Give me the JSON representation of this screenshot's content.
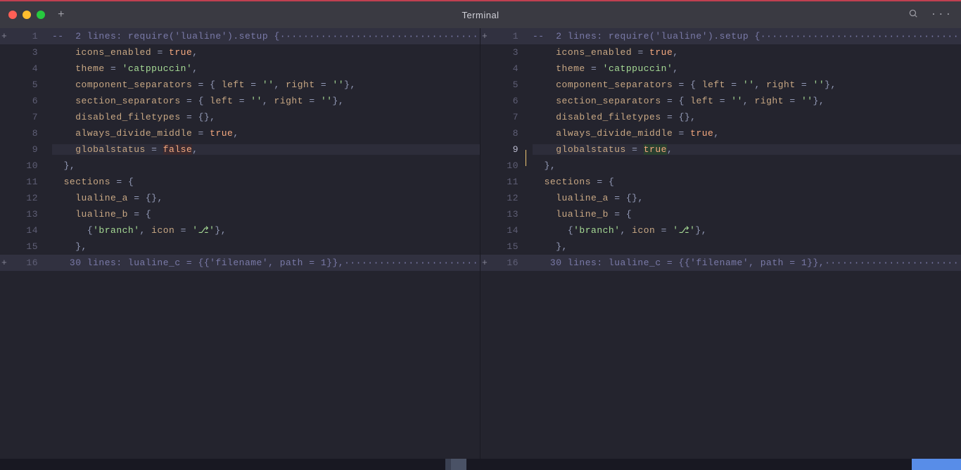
{
  "window": {
    "title": "Terminal",
    "newTabGlyph": "+",
    "moreGlyph": "···"
  },
  "panes": [
    {
      "side": "left",
      "lines": [
        {
          "num": "1",
          "fold": "+",
          "folded": true,
          "tokens": [
            {
              "t": "--  2 lines: require('lualine').setup {",
              "cls": "folded-text"
            }
          ],
          "trailDots": true
        },
        {
          "num": "3",
          "tokens": [
            {
              "t": "    ",
              "cls": ""
            },
            {
              "t": "icons_enabled",
              "cls": "key"
            },
            {
              "t": " = ",
              "cls": "op"
            },
            {
              "t": "true",
              "cls": "bool"
            },
            {
              "t": ",",
              "cls": "punc"
            }
          ]
        },
        {
          "num": "4",
          "tokens": [
            {
              "t": "    ",
              "cls": ""
            },
            {
              "t": "theme",
              "cls": "key"
            },
            {
              "t": " = ",
              "cls": "op"
            },
            {
              "t": "'catppuccin'",
              "cls": "str"
            },
            {
              "t": ",",
              "cls": "punc"
            }
          ]
        },
        {
          "num": "5",
          "tokens": [
            {
              "t": "    ",
              "cls": ""
            },
            {
              "t": "component_separators",
              "cls": "key"
            },
            {
              "t": " = ",
              "cls": "op"
            },
            {
              "t": "{ ",
              "cls": "punc"
            },
            {
              "t": "left",
              "cls": "key"
            },
            {
              "t": " = ",
              "cls": "op"
            },
            {
              "t": "''",
              "cls": "str"
            },
            {
              "t": ", ",
              "cls": "punc"
            },
            {
              "t": "right",
              "cls": "key"
            },
            {
              "t": " = ",
              "cls": "op"
            },
            {
              "t": "''",
              "cls": "str"
            },
            {
              "t": "},",
              "cls": "punc"
            }
          ]
        },
        {
          "num": "6",
          "tokens": [
            {
              "t": "    ",
              "cls": ""
            },
            {
              "t": "section_separators",
              "cls": "key"
            },
            {
              "t": " = ",
              "cls": "op"
            },
            {
              "t": "{ ",
              "cls": "punc"
            },
            {
              "t": "left",
              "cls": "key"
            },
            {
              "t": " = ",
              "cls": "op"
            },
            {
              "t": "''",
              "cls": "str"
            },
            {
              "t": ", ",
              "cls": "punc"
            },
            {
              "t": "right",
              "cls": "key"
            },
            {
              "t": " = ",
              "cls": "op"
            },
            {
              "t": "''",
              "cls": "str"
            },
            {
              "t": "},",
              "cls": "punc"
            }
          ]
        },
        {
          "num": "7",
          "tokens": [
            {
              "t": "    ",
              "cls": ""
            },
            {
              "t": "disabled_filetypes",
              "cls": "key"
            },
            {
              "t": " = ",
              "cls": "op"
            },
            {
              "t": "{}",
              "cls": "punc"
            },
            {
              "t": ",",
              "cls": "punc"
            }
          ]
        },
        {
          "num": "8",
          "tokens": [
            {
              "t": "    ",
              "cls": ""
            },
            {
              "t": "always_divide_middle",
              "cls": "key"
            },
            {
              "t": " = ",
              "cls": "op"
            },
            {
              "t": "true",
              "cls": "bool"
            },
            {
              "t": ",",
              "cls": "punc"
            }
          ]
        },
        {
          "num": "9",
          "hl": true,
          "tokens": [
            {
              "t": "    ",
              "cls": ""
            },
            {
              "t": "globalstatus",
              "cls": "key"
            },
            {
              "t": " = ",
              "cls": "op"
            },
            {
              "t": "false",
              "cls": "bool-diff",
              "diffRemoved": true
            },
            {
              "t": ",",
              "cls": "punc"
            }
          ]
        },
        {
          "num": "10",
          "tokens": [
            {
              "t": "  ",
              "cls": ""
            },
            {
              "t": "},",
              "cls": "punc"
            }
          ]
        },
        {
          "num": "11",
          "tokens": [
            {
              "t": "  ",
              "cls": ""
            },
            {
              "t": "sections",
              "cls": "key"
            },
            {
              "t": " = ",
              "cls": "op"
            },
            {
              "t": "{",
              "cls": "punc"
            }
          ]
        },
        {
          "num": "12",
          "tokens": [
            {
              "t": "    ",
              "cls": ""
            },
            {
              "t": "lualine_a",
              "cls": "key"
            },
            {
              "t": " = ",
              "cls": "op"
            },
            {
              "t": "{}",
              "cls": "punc"
            },
            {
              "t": ",",
              "cls": "punc"
            }
          ]
        },
        {
          "num": "13",
          "tokens": [
            {
              "t": "    ",
              "cls": ""
            },
            {
              "t": "lualine_b",
              "cls": "key"
            },
            {
              "t": " = ",
              "cls": "op"
            },
            {
              "t": "{",
              "cls": "punc"
            }
          ]
        },
        {
          "num": "14",
          "tokens": [
            {
              "t": "      ",
              "cls": ""
            },
            {
              "t": "{",
              "cls": "punc"
            },
            {
              "t": "'branch'",
              "cls": "str"
            },
            {
              "t": ", ",
              "cls": "punc"
            },
            {
              "t": "icon",
              "cls": "key"
            },
            {
              "t": " = ",
              "cls": "op"
            },
            {
              "t": "'⎇'",
              "cls": "str"
            },
            {
              "t": "}",
              "cls": "punc"
            },
            {
              "t": ",",
              "cls": "punc"
            }
          ]
        },
        {
          "num": "15",
          "tokens": [
            {
              "t": "    ",
              "cls": ""
            },
            {
              "t": "},",
              "cls": "punc"
            }
          ]
        },
        {
          "num": "16",
          "fold": "+",
          "folded": true,
          "tokens": [
            {
              "t": "   30 lines: lualine_c = {{'filename', path = 1}},",
              "cls": "folded-text"
            }
          ],
          "trailDots": true
        }
      ]
    },
    {
      "side": "right",
      "cursorLine": 7,
      "lines": [
        {
          "num": "1",
          "fold": "+",
          "folded": true,
          "tokens": [
            {
              "t": "--  2 lines: require('lualine').setup {",
              "cls": "folded-text"
            }
          ],
          "trailDots": true
        },
        {
          "num": "3",
          "tokens": [
            {
              "t": "    ",
              "cls": ""
            },
            {
              "t": "icons_enabled",
              "cls": "key"
            },
            {
              "t": " = ",
              "cls": "op"
            },
            {
              "t": "true",
              "cls": "bool"
            },
            {
              "t": ",",
              "cls": "punc"
            }
          ]
        },
        {
          "num": "4",
          "tokens": [
            {
              "t": "    ",
              "cls": ""
            },
            {
              "t": "theme",
              "cls": "key"
            },
            {
              "t": " = ",
              "cls": "op"
            },
            {
              "t": "'catppuccin'",
              "cls": "str"
            },
            {
              "t": ",",
              "cls": "punc"
            }
          ]
        },
        {
          "num": "5",
          "tokens": [
            {
              "t": "    ",
              "cls": ""
            },
            {
              "t": "component_separators",
              "cls": "key"
            },
            {
              "t": " = ",
              "cls": "op"
            },
            {
              "t": "{ ",
              "cls": "punc"
            },
            {
              "t": "left",
              "cls": "key"
            },
            {
              "t": " = ",
              "cls": "op"
            },
            {
              "t": "''",
              "cls": "str"
            },
            {
              "t": ", ",
              "cls": "punc"
            },
            {
              "t": "right",
              "cls": "key"
            },
            {
              "t": " = ",
              "cls": "op"
            },
            {
              "t": "''",
              "cls": "str"
            },
            {
              "t": "},",
              "cls": "punc"
            }
          ]
        },
        {
          "num": "6",
          "tokens": [
            {
              "t": "    ",
              "cls": ""
            },
            {
              "t": "section_separators",
              "cls": "key"
            },
            {
              "t": " = ",
              "cls": "op"
            },
            {
              "t": "{ ",
              "cls": "punc"
            },
            {
              "t": "left",
              "cls": "key"
            },
            {
              "t": " = ",
              "cls": "op"
            },
            {
              "t": "''",
              "cls": "str"
            },
            {
              "t": ", ",
              "cls": "punc"
            },
            {
              "t": "right",
              "cls": "key"
            },
            {
              "t": " = ",
              "cls": "op"
            },
            {
              "t": "''",
              "cls": "str"
            },
            {
              "t": "},",
              "cls": "punc"
            }
          ]
        },
        {
          "num": "7",
          "tokens": [
            {
              "t": "    ",
              "cls": ""
            },
            {
              "t": "disabled_filetypes",
              "cls": "key"
            },
            {
              "t": " = ",
              "cls": "op"
            },
            {
              "t": "{}",
              "cls": "punc"
            },
            {
              "t": ",",
              "cls": "punc"
            }
          ]
        },
        {
          "num": "8",
          "tokens": [
            {
              "t": "    ",
              "cls": ""
            },
            {
              "t": "always_divide_middle",
              "cls": "key"
            },
            {
              "t": " = ",
              "cls": "op"
            },
            {
              "t": "true",
              "cls": "bool"
            },
            {
              "t": ",",
              "cls": "punc"
            }
          ]
        },
        {
          "num": "9",
          "hl": true,
          "cursor": true,
          "current": true,
          "tokens": [
            {
              "t": "    ",
              "cls": ""
            },
            {
              "t": "globalstatus",
              "cls": "key"
            },
            {
              "t": " = ",
              "cls": "op"
            },
            {
              "t": "true",
              "cls": "bool-diff",
              "diffAdded": true
            },
            {
              "t": ",",
              "cls": "punc"
            }
          ]
        },
        {
          "num": "10",
          "tokens": [
            {
              "t": "  ",
              "cls": ""
            },
            {
              "t": "},",
              "cls": "punc"
            }
          ]
        },
        {
          "num": "11",
          "tokens": [
            {
              "t": "  ",
              "cls": ""
            },
            {
              "t": "sections",
              "cls": "key"
            },
            {
              "t": " = ",
              "cls": "op"
            },
            {
              "t": "{",
              "cls": "punc"
            }
          ]
        },
        {
          "num": "12",
          "tokens": [
            {
              "t": "    ",
              "cls": ""
            },
            {
              "t": "lualine_a",
              "cls": "key"
            },
            {
              "t": " = ",
              "cls": "op"
            },
            {
              "t": "{}",
              "cls": "punc"
            },
            {
              "t": ",",
              "cls": "punc"
            }
          ]
        },
        {
          "num": "13",
          "tokens": [
            {
              "t": "    ",
              "cls": ""
            },
            {
              "t": "lualine_b",
              "cls": "key"
            },
            {
              "t": " = ",
              "cls": "op"
            },
            {
              "t": "{",
              "cls": "punc"
            }
          ]
        },
        {
          "num": "14",
          "tokens": [
            {
              "t": "      ",
              "cls": ""
            },
            {
              "t": "{",
              "cls": "punc"
            },
            {
              "t": "'branch'",
              "cls": "str"
            },
            {
              "t": ", ",
              "cls": "punc"
            },
            {
              "t": "icon",
              "cls": "key"
            },
            {
              "t": " = ",
              "cls": "op"
            },
            {
              "t": "'⎇'",
              "cls": "str"
            },
            {
              "t": "}",
              "cls": "punc"
            },
            {
              "t": ",",
              "cls": "punc"
            }
          ]
        },
        {
          "num": "15",
          "tokens": [
            {
              "t": "    ",
              "cls": ""
            },
            {
              "t": "},",
              "cls": "punc"
            }
          ]
        },
        {
          "num": "16",
          "fold": "+",
          "folded": true,
          "tokens": [
            {
              "t": "   30 lines: lualine_c = {{'filename', path = 1}},",
              "cls": "folded-text"
            }
          ],
          "trailDots": true
        }
      ]
    }
  ]
}
